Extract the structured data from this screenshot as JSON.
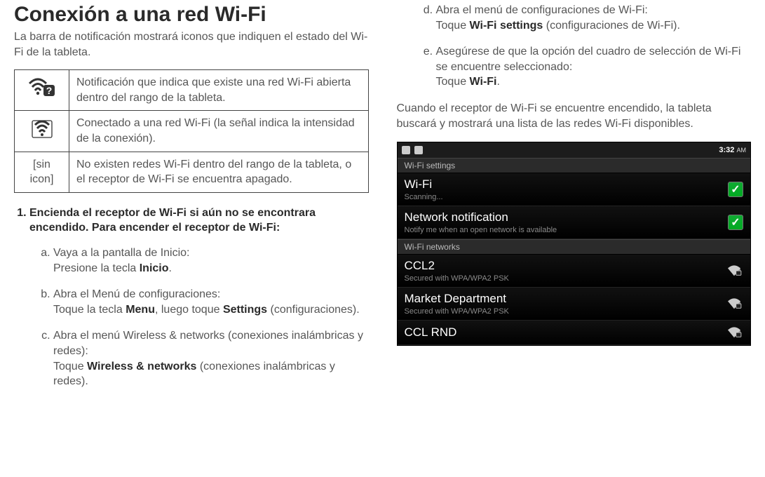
{
  "left": {
    "heading": "Conexión a una red Wi-Fi",
    "intro": "La barra de notificación mostrará iconos que indiquen el estado del Wi-Fi de la tableta.",
    "icon_table": {
      "row1": {
        "desc": "Notificación que indica que existe una red Wi-Fi abierta dentro del rango de la tableta."
      },
      "row2": {
        "desc": "Conectado a una red Wi-Fi (la señal indica la intensidad de la conexión)."
      },
      "row3": {
        "label": "[sin icon]",
        "desc": "No existen redes Wi-Fi dentro del rango de la tableta, o el receptor de Wi-Fi se encuentra apagado."
      }
    },
    "step1": "Encienda el receptor de Wi-Fi si aún no se encontrara encendido. Para encender el receptor de Wi-Fi:",
    "sub": {
      "a1": "Vaya a la pantalla de Inicio:",
      "a2_pre": "Presione la tecla ",
      "a2_bold": "Inicio",
      "a2_post": ".",
      "b1": "Abra el Menú de configuraciones:",
      "b2_pre": "Toque la tecla ",
      "b2_bold1": "Menu",
      "b2_mid": ", luego toque ",
      "b2_bold2": "Settings",
      "b2_post": " (configuraciones).",
      "c1": "Abra el menú Wireless & networks (conexiones inalámbricas y redes):",
      "c2_pre": "Toque ",
      "c2_bold": "Wireless & networks",
      "c2_post": " (conexiones inalámbricas y redes)."
    }
  },
  "right": {
    "sub": {
      "d1": "Abra el menú de configuraciones de Wi-Fi:",
      "d2_pre": "Toque ",
      "d2_bold": "Wi-Fi settings",
      "d2_post": " (configuraciones de Wi-Fi).",
      "e1": "Asegúrese de que la opción del cuadro de selección de Wi-Fi se encuentre seleccionado:",
      "e2_pre": "Toque ",
      "e2_bold": "Wi-Fi",
      "e2_post": "."
    },
    "para": "Cuando el receptor de Wi-Fi se encuentre encendido, la tableta buscará y mostrará una lista de las redes Wi-Fi disponibles.",
    "screenshot": {
      "time": "3:32",
      "ampm": "AM",
      "header": "Wi-Fi settings",
      "wifi_title": "Wi-Fi",
      "wifi_sub": "Scanning...",
      "notif_title": "Network notification",
      "notif_sub": "Notify me when an open network is available",
      "section": "Wi-Fi networks",
      "net1_title": "CCL2",
      "net1_sub": "Secured with WPA/WPA2 PSK",
      "net2_title": "Market Department",
      "net2_sub": "Secured with WPA/WPA2 PSK",
      "net3_title": "CCL RND"
    }
  }
}
